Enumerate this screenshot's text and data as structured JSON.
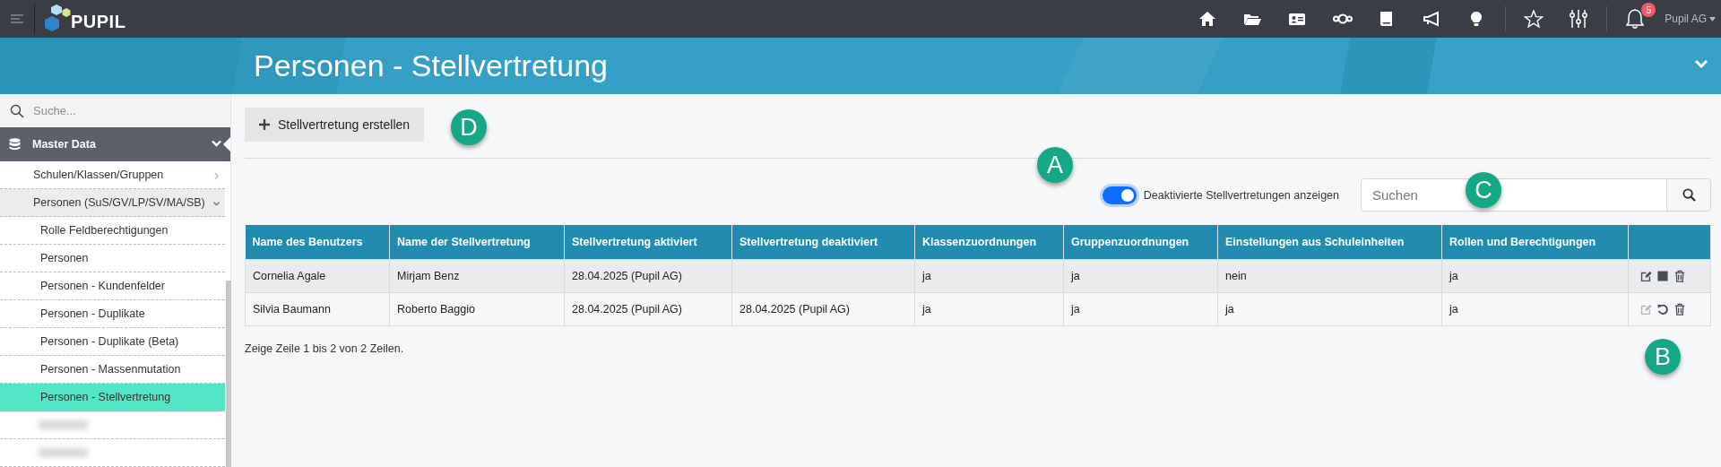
{
  "topbar": {
    "brand": "PUPIL",
    "notifications": "5",
    "user": "Pupil AG"
  },
  "header": {
    "title": "Personen - Stellvertretung"
  },
  "sidebar": {
    "search": {
      "placeholder": "Suche..."
    },
    "section": {
      "label": "Master Data",
      "expanded": true
    },
    "items": [
      {
        "label": "Schulen/Klassen/Gruppen",
        "expanded": false
      },
      {
        "label": "Personen (SuS/GV/LP/SV/MA/SB)",
        "expanded": true,
        "children": [
          {
            "label": "Rolle Feldberechtigungen",
            "selected": false
          },
          {
            "label": "Personen",
            "selected": false
          },
          {
            "label": "Personen - Kundenfelder",
            "selected": false
          },
          {
            "label": "Personen - Duplikate",
            "selected": false
          },
          {
            "label": "Personen - Duplikate (Beta)",
            "selected": false
          },
          {
            "label": "Personen - Massenmutation",
            "selected": false
          },
          {
            "label": "Personen - Stellvertretung",
            "selected": true
          }
        ]
      }
    ]
  },
  "create_button": {
    "label": "Stellvertretung erstellen"
  },
  "toggle": {
    "label": "Deaktivierte Stellvertretungen anzeigen",
    "on": true
  },
  "search": {
    "placeholder": "Suchen"
  },
  "table": {
    "columns": [
      "Name des Benutzers",
      "Name der Stellvertretung",
      "Stellvertretung aktiviert",
      "Stellvertretung deaktiviert",
      "Klassenzuordnungen",
      "Gruppenzuordnungen",
      "Einstellungen aus Schuleinheiten",
      "Rollen und Berechtigungen"
    ],
    "rows": [
      {
        "cells": [
          "Cornelia Agale",
          "Mirjam Benz",
          "28.04.2025 (Pupil AG)",
          null,
          "ja",
          "ja",
          "nein",
          "ja"
        ],
        "actions": [
          {
            "kind": "edit",
            "disabled": false
          },
          {
            "kind": "stop",
            "disabled": false
          },
          {
            "kind": "delete",
            "disabled": false
          }
        ]
      },
      {
        "cells": [
          "Silvia Baumann",
          "Roberto Baggio",
          "28.04.2025 (Pupil AG)",
          "28.04.2025 (Pupil AG)",
          "ja",
          "ja",
          "ja",
          "ja"
        ],
        "actions": [
          {
            "kind": "edit",
            "disabled": true
          },
          {
            "kind": "restore",
            "disabled": false
          },
          {
            "kind": "delete",
            "disabled": false
          }
        ]
      }
    ]
  },
  "footer": "Zeige Zeile 1 bis 2 von 2 Zeilen.",
  "annotations": [
    {
      "label": "D"
    },
    {
      "label": "A"
    },
    {
      "label": "C"
    },
    {
      "label": "B"
    }
  ]
}
